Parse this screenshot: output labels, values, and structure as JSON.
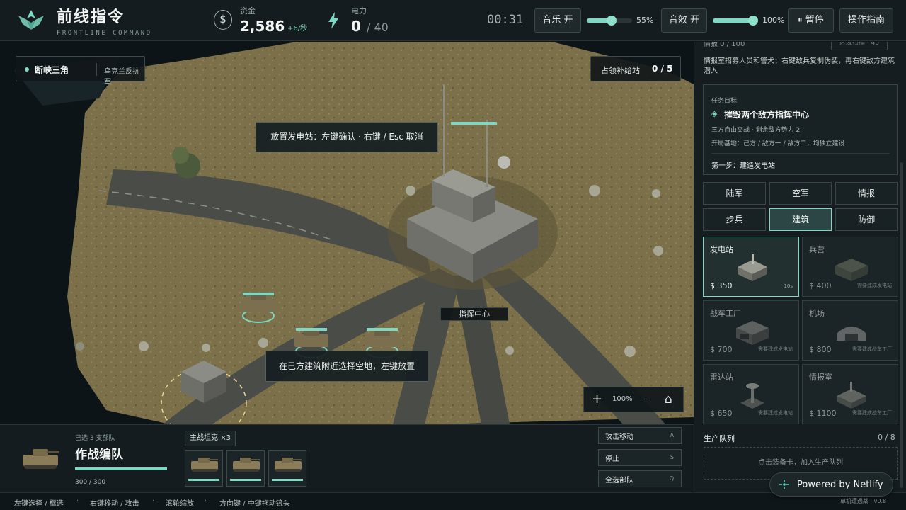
{
  "header": {
    "title": "前线指令",
    "subtitle": "FRONTLINE COMMAND",
    "funds_label": "资金",
    "funds_value": "2,586",
    "funds_rate": "+6/秒",
    "power_label": "电力",
    "power_current": "0",
    "power_max": "/ 40",
    "timer": "00:31",
    "music_button": "音乐 开",
    "music_volume": "55%",
    "sfx_button": "音效 开",
    "sfx_volume": "100%",
    "pause_button": "⏸ 暂停",
    "guide_button": "操作指南"
  },
  "map": {
    "region_name": "断峡三角",
    "region_faction": "乌克兰反抗军",
    "supply_label": "占领补给站",
    "supply_count": "0 / 5",
    "placement_hint": "放置发电站：左键确认 · 右键 / Esc 取消",
    "select_hint": "在己方建筑附近选择空地，左键放置",
    "command_center_label": "指挥中心",
    "zoom_in": "+",
    "zoom_level": "100%",
    "zoom_out": "—",
    "home": "⌂"
  },
  "selection": {
    "count_text": "已选 3 支部队",
    "group_name": "作战编队",
    "hp_text": "300 / 300",
    "hp_fraction": 1.0,
    "unit_tag": "主战坦克 ×3",
    "commands": [
      {
        "label": "攻击移动",
        "key": "A"
      },
      {
        "label": "停止",
        "key": "S"
      },
      {
        "label": "全选部队",
        "key": "Q"
      }
    ]
  },
  "help": {
    "items": [
      "左键选择 / 框选",
      "右键移动 / 攻击",
      "滚轮缩放",
      "方向键 / 中键拖动镜头"
    ],
    "sep": "·",
    "version": "单机遭遇战 · v0.8"
  },
  "sidebar": {
    "intel_top": "情报 0 / 100",
    "intel_top_btn": "区域扫描 · 40",
    "intel_desc": "情报室招募人员和警犬；右键敌兵复制伪装，再右键敌方建筑潜入",
    "mission_label": "任务目标",
    "mission_goal": "摧毁两个敌方指挥中心",
    "mission_line1": "三方自由交战 · 剩余敌方势力 2",
    "mission_line2": "开局基地：己方 / 敌方一 / 敌方二，均独立建设",
    "mission_step": "第一步：建造发电站",
    "tabs": [
      {
        "label": "陆军",
        "active": false
      },
      {
        "label": "空军",
        "active": false
      },
      {
        "label": "情报",
        "active": false
      },
      {
        "label": "步兵",
        "active": false
      },
      {
        "label": "建筑",
        "active": true
      },
      {
        "label": "防御",
        "active": false
      }
    ],
    "buildings": [
      {
        "name": "发电站",
        "price": "$ 350",
        "time": "10s",
        "req": ""
      },
      {
        "name": "兵营",
        "price": "$ 400",
        "time": "",
        "req": "需要建成发电站"
      },
      {
        "name": "战车工厂",
        "price": "$ 700",
        "time": "",
        "req": "需要建成发电站"
      },
      {
        "name": "机场",
        "price": "$ 800",
        "time": "",
        "req": "需要建成战车工厂"
      },
      {
        "name": "雷达站",
        "price": "$ 650",
        "time": "",
        "req": "需要建成发电站"
      },
      {
        "name": "情报室",
        "price": "$ 1100",
        "time": "",
        "req": "需要建成战车工厂"
      }
    ],
    "queue_label": "生产队列",
    "queue_count": "0 / 8",
    "queue_empty": "点击装备卡，加入生产队列"
  },
  "netlify": {
    "text": "Powered by Netlify"
  },
  "colors": {
    "accent": "#7fd8c3",
    "panel": "#151d20",
    "terrain": "#7a6e4a"
  }
}
